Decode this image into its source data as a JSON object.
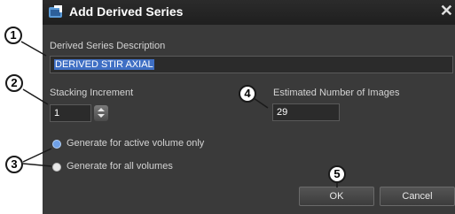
{
  "dialog": {
    "title": "Add Derived Series",
    "close_label": "✕"
  },
  "description": {
    "label": "Derived Series Description",
    "value": "DERIVED STIR AXIAL"
  },
  "stacking": {
    "label": "Stacking Increment",
    "value": "1"
  },
  "estimated": {
    "label": "Estimated Number of Images",
    "value": "29"
  },
  "options": {
    "active_only": {
      "label": "Generate for active volume only",
      "selected": true
    },
    "all_volumes": {
      "label": "Generate for all volumes",
      "selected": false
    }
  },
  "buttons": {
    "ok": "OK",
    "cancel": "Cancel"
  },
  "callouts": {
    "c1": "1",
    "c2": "2",
    "c3": "3",
    "c4": "4",
    "c5": "5"
  },
  "colors": {
    "dialog_bg": "#3a3a3a",
    "selection": "#3f6fc4",
    "radio_selected": "#6fa0e6"
  }
}
